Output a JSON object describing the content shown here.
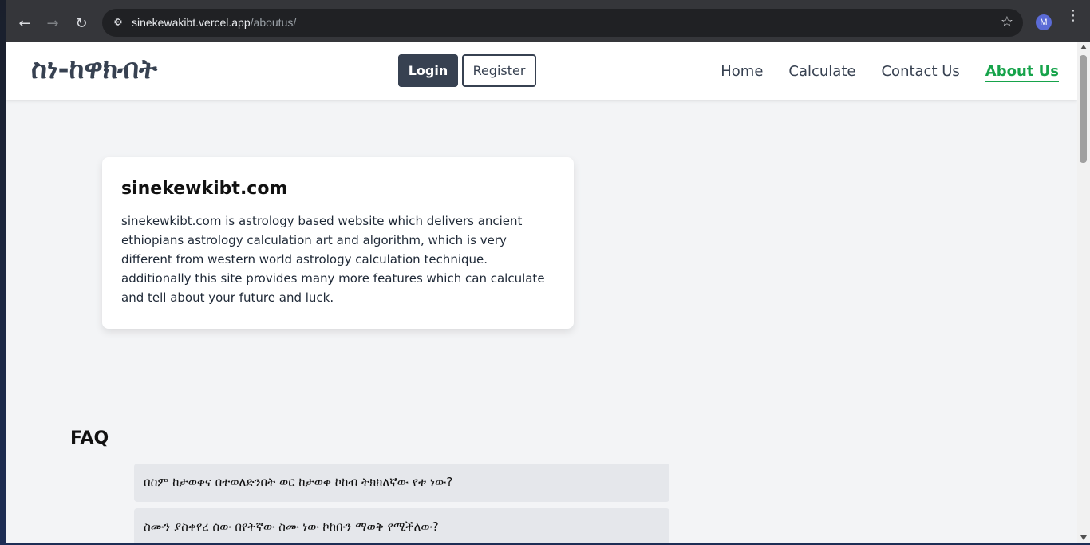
{
  "browser": {
    "url_host": "sinekewakibt.vercel.app",
    "url_path": "/aboutus/",
    "profile_initial": "M",
    "icons": [
      "back-icon",
      "forward-icon",
      "reload-icon",
      "site-info-icon",
      "bookmark-star-icon",
      "menu-kebab-icon"
    ]
  },
  "navbar": {
    "logo": "ስነ-ከዋክብት",
    "login_label": "Login",
    "register_label": "Register",
    "links": [
      {
        "label": "Home"
      },
      {
        "label": "Calculate"
      },
      {
        "label": "Contact Us"
      },
      {
        "label": "About Us",
        "active": true
      }
    ],
    "active_color": "#16a34a"
  },
  "about": {
    "title": "sinekewkibt.com",
    "body": "sinekewkibt.com is astrology based website which delivers ancient ethiopians astrology calculation art and algorithm, which is very different from western world astrology calculation technique. additionally this site provides many more features which can calculate and tell about your future and luck."
  },
  "faq": {
    "title": "FAQ",
    "items": [
      {
        "question": "በስም ከታወቀና በተወለድንበት ወር ከታወቀ ኮከብ ትክክለኛው የቱ ነው?"
      },
      {
        "question": "ስሙን ያስቀየረ ሰው በየትኛው ስሙ ነው ኮከቡን ማወቅ የሚችለው?"
      }
    ]
  }
}
